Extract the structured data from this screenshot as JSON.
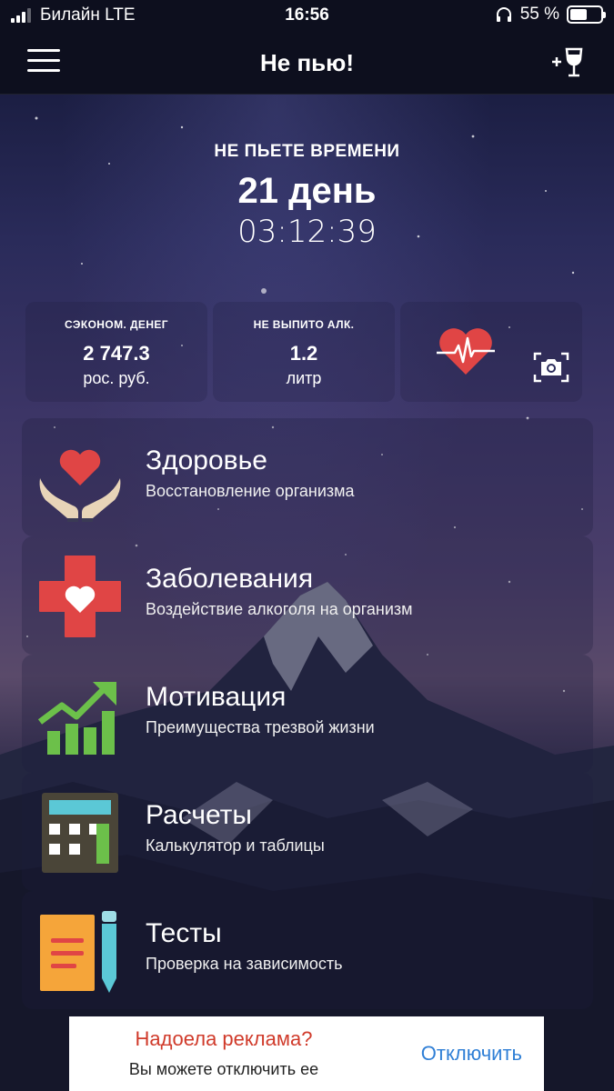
{
  "status_bar": {
    "carrier": "Билайн LTE",
    "time": "16:56",
    "battery_percent": "55 %",
    "battery_level": 0.55
  },
  "nav": {
    "title": "Не пью!",
    "menu_icon": "hamburger-menu-icon",
    "add_icon": "add-wine-glass-icon"
  },
  "timer": {
    "label": "НЕ ПЬЕТЕ ВРЕМЕНИ",
    "days": "21 день",
    "clock": "03:12:39"
  },
  "stats": {
    "saved": {
      "label": "СЭКОНОМ. ДЕНЕГ",
      "value": "2 747.3",
      "unit": "рос. руб."
    },
    "alcohol": {
      "label": "НЕ ВЫПИТО АЛК.",
      "value": "1.2",
      "unit": "литр"
    },
    "heart_icon": "heart-ecg-icon",
    "camera_icon": "camera-icon"
  },
  "menu": [
    {
      "title": "Здоровье",
      "subtitle": "Восстановление организма",
      "icon": "heart-in-hands-icon"
    },
    {
      "title": "Заболевания",
      "subtitle": "Воздействие алкоголя на организм",
      "icon": "medical-cross-heart-icon"
    },
    {
      "title": "Мотивация",
      "subtitle": "Преимущества трезвой жизни",
      "icon": "growth-chart-icon"
    },
    {
      "title": "Расчеты",
      "subtitle": "Калькулятор и таблицы",
      "icon": "calculator-icon"
    },
    {
      "title": "Тесты",
      "subtitle": "Проверка на зависимость",
      "icon": "notepad-pencil-icon"
    }
  ],
  "ad": {
    "title": "Надоела реклама?",
    "text": "Вы можете отключить ее",
    "button": "Отключить"
  },
  "colors": {
    "heart_red": "#e04545",
    "chart_green": "#6cc04a",
    "calc_teal": "#5bc8d6",
    "note_orange": "#f5a53a",
    "ad_red": "#d03a2a",
    "ad_blue": "#2f7fd6"
  }
}
